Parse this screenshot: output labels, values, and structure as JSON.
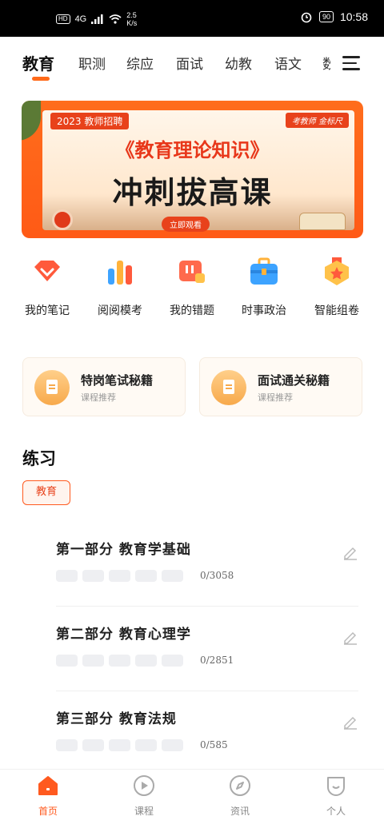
{
  "status_bar": {
    "left_badges": "HD",
    "network": "4G",
    "speed": "2.5",
    "speed_unit": "K/s",
    "battery": "90",
    "time": "10:58"
  },
  "top_tabs": [
    "教育",
    "职测",
    "综应",
    "面试",
    "幼教",
    "语文",
    "数"
  ],
  "banner": {
    "year_tag": "2023 教师招聘",
    "brand_tag": "考教师  金标尺",
    "headline": "《教育理论知识》",
    "title": "冲刺拔高课",
    "cta": "立即观看"
  },
  "features": [
    {
      "label": "我的笔记",
      "icon": "heart-folder-icon"
    },
    {
      "label": "阅阅模考",
      "icon": "bar-chart-icon"
    },
    {
      "label": "我的错题",
      "icon": "wrong-question-icon"
    },
    {
      "label": "时事政治",
      "icon": "briefcase-icon"
    },
    {
      "label": "智能组卷",
      "icon": "medal-icon"
    }
  ],
  "recommend_cards": [
    {
      "title": "特岗笔试秘籍",
      "subtitle": "课程推荐"
    },
    {
      "title": "面试通关秘籍",
      "subtitle": "课程推荐"
    }
  ],
  "practice": {
    "section_title": "练习",
    "chip": "教育",
    "items": [
      {
        "title": "第一部分  教育学基础",
        "count": "0/3058"
      },
      {
        "title": "第二部分  教育心理学",
        "count": "0/2851"
      },
      {
        "title": "第三部分  教育法规",
        "count": "0/585"
      }
    ]
  },
  "bottom_nav": [
    {
      "label": "首页",
      "icon": "home-icon",
      "active": true
    },
    {
      "label": "课程",
      "icon": "play-icon",
      "active": false
    },
    {
      "label": "资讯",
      "icon": "compass-icon",
      "active": false
    },
    {
      "label": "个人",
      "icon": "profile-icon",
      "active": false
    }
  ],
  "colors": {
    "accent": "#ff5a1f",
    "banner_red": "#e8421b"
  }
}
